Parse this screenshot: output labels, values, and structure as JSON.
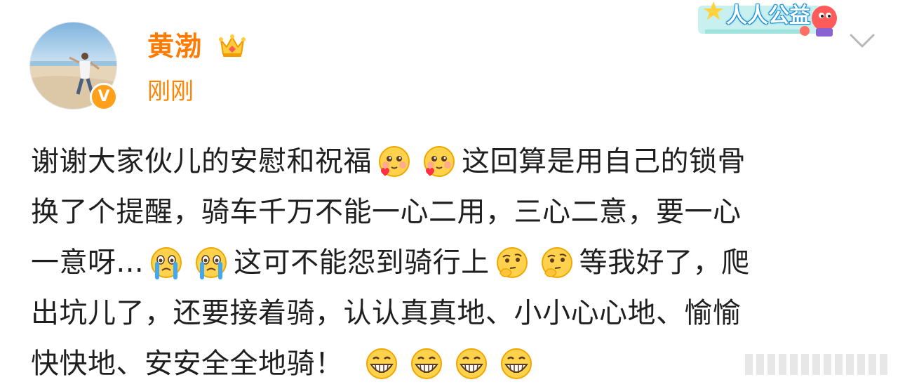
{
  "post": {
    "author": "黄渤",
    "timestamp": "刚刚",
    "campaign_badge": "人人公益",
    "verified_badge": "V",
    "lines": [
      {
        "t1": "谢谢大家伙儿的安慰和祝福",
        "t2": "这回算是用自己的锁骨"
      },
      {
        "t1": "换了个提醒，骑车千万不能一心二用，三心二意，要一心"
      },
      {
        "t1": "一意呀...",
        "t2": "这可不能怨到骑行上",
        "t3": "等我好了，爬"
      },
      {
        "t1": "出坑儿了，还要接着骑，认认真真地、小小心心地、愉愉"
      },
      {
        "t1": "快快地、安安全全地骑！"
      }
    ]
  },
  "icons": {
    "crown": "crown-icon",
    "verified": "verified-v-icon",
    "chevron": "chevron-down-icon",
    "emoji_love": "heart-eyes-emoji",
    "emoji_cry": "crying-emoji",
    "emoji_think": "thinking-emoji",
    "emoji_grin": "grinning-emoji"
  },
  "colors": {
    "author": "#ff7a00",
    "timestamp": "#ff8200",
    "text": "#1f1f1f",
    "verified": "#ff9f1a",
    "campaign": "#1a8fd8"
  }
}
